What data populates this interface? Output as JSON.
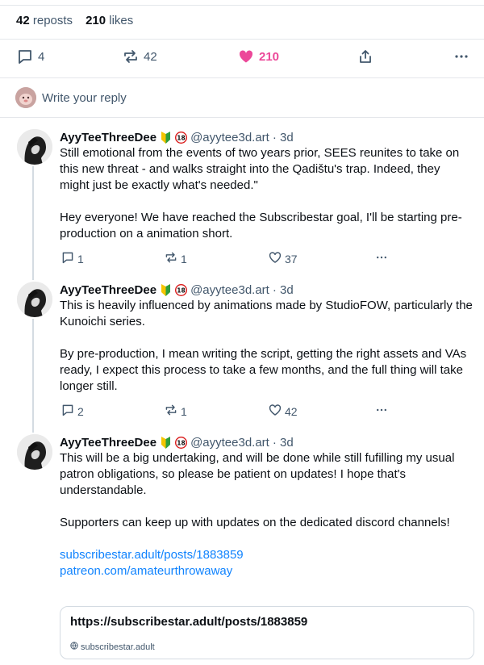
{
  "stats": {
    "reposts_count": "42",
    "reposts_label": "reposts",
    "likes_count": "210",
    "likes_label": "likes"
  },
  "actions": {
    "replies": "4",
    "reposts": "42",
    "likes": "210"
  },
  "reply_bar": {
    "placeholder": "Write your reply"
  },
  "colors": {
    "like": "#ec4899",
    "link": "#1083fe",
    "muted": "#42576c",
    "border": "#e4e7eb"
  },
  "posts": [
    {
      "author": "AyyTeeThreeDee",
      "handle": "@ayytee3d.art",
      "time": "· 3d",
      "text": [
        "Still emotional from the events of two years prior, SEES reunites to take on this new threat - and walks straight into the Qadištu's trap. Indeed, they might just be exactly what's needed.\"",
        "Hey everyone! We have reached the Subscribestar goal, I'll be starting pre-production on a animation short."
      ],
      "replies": "1",
      "reposts": "1",
      "likes": "37"
    },
    {
      "author": "AyyTeeThreeDee",
      "handle": "@ayytee3d.art",
      "time": "· 3d",
      "text": [
        "This is heavily influenced by animations made by StudioFOW, particularly the Kunoichi series.",
        "By pre-production, I mean writing the script, getting the right assets and VAs ready, I expect this process to take a few months, and the full thing will take longer still."
      ],
      "replies": "2",
      "reposts": "1",
      "likes": "42"
    },
    {
      "author": "AyyTeeThreeDee",
      "handle": "@ayytee3d.art",
      "time": "· 3d",
      "text": [
        "This will be a big undertaking, and will be done while still fufilling my usual patron obligations, so please be patient on updates! I hope that's understandable.",
        "Supporters can keep up with updates on the dedicated discord channels!"
      ],
      "links": [
        "subscribestar.adult/posts/1883859",
        "patreon.com/amateurthrowaway"
      ],
      "card": {
        "title": "https://subscribestar.adult/posts/1883859",
        "domain": "subscribestar.adult"
      }
    }
  ]
}
